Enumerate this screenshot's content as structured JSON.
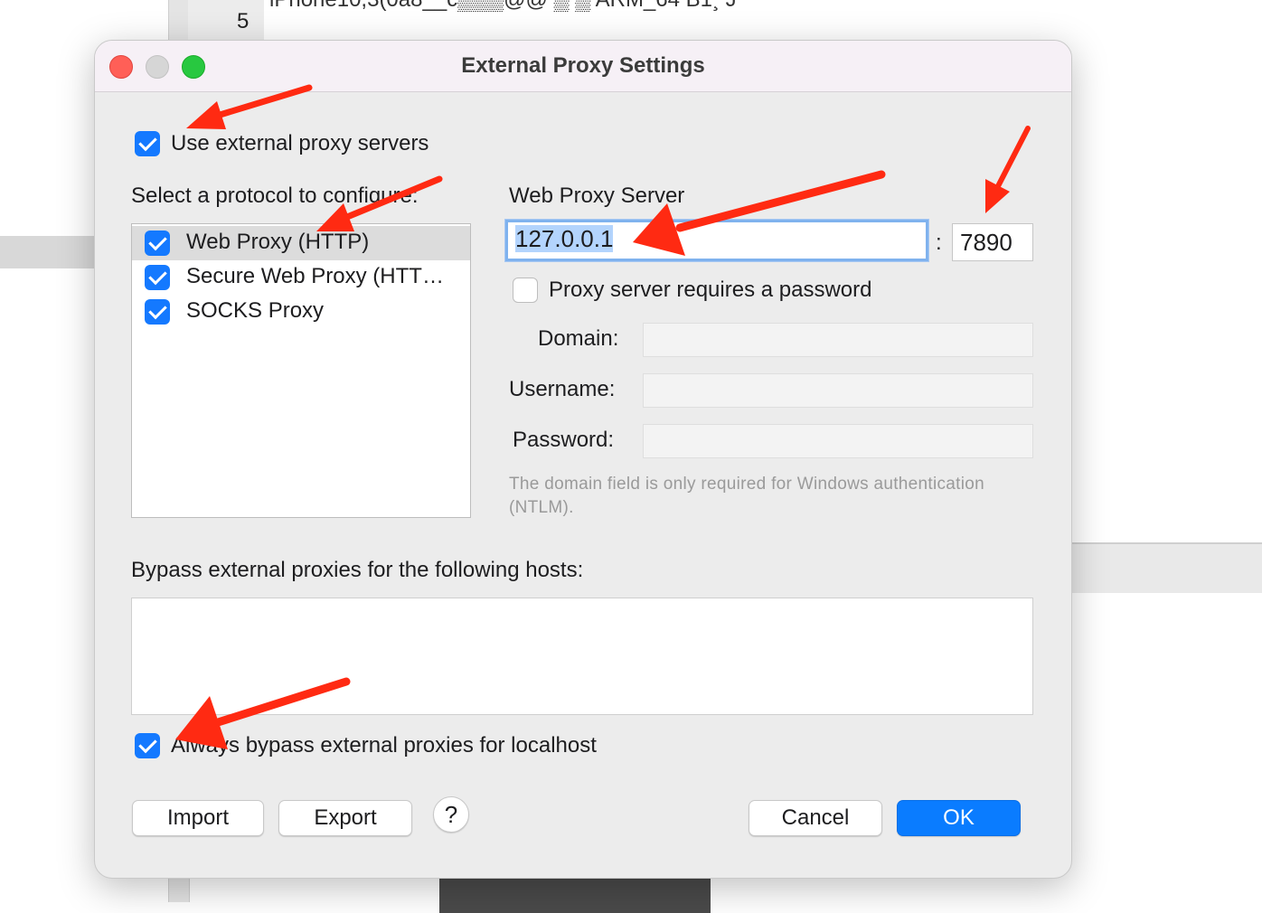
{
  "background": {
    "line_number": "5",
    "garbled_text": "iPhone10,3(0a8__c▒▒▒@@ ▒ ▒ ARM_64 B1¸ J"
  },
  "dialog": {
    "title": "External Proxy Settings",
    "use_external_label": "Use external proxy servers",
    "use_external_checked": true,
    "protocol_heading": "Select a protocol to configure:",
    "protocols": [
      {
        "label": "Web Proxy (HTTP)",
        "checked": true,
        "selected": true
      },
      {
        "label": "Secure Web Proxy (HTT…",
        "checked": true,
        "selected": false
      },
      {
        "label": "SOCKS Proxy",
        "checked": true,
        "selected": false
      }
    ],
    "server_heading": "Web Proxy Server",
    "server_host": "127.0.0.1",
    "port_separator": ":",
    "server_port": "7890",
    "requires_password_label": "Proxy server requires a password",
    "requires_password_checked": false,
    "domain_label": "Domain:",
    "username_label": "Username:",
    "password_label": "Password:",
    "domain_hint": "The domain field is only required for Windows authentication (NTLM).",
    "bypass_heading": "Bypass external proxies for the following hosts:",
    "bypass_hosts": "",
    "bypass_localhost_label": "Always bypass external proxies for localhost",
    "bypass_localhost_checked": true,
    "buttons": {
      "import": "Import",
      "export": "Export",
      "help": "?",
      "cancel": "Cancel",
      "ok": "OK"
    }
  },
  "colors": {
    "accent": "#1479ff",
    "annotation_arrow": "#ff2a12",
    "close": "#ff5f57",
    "maximize": "#28c840"
  }
}
